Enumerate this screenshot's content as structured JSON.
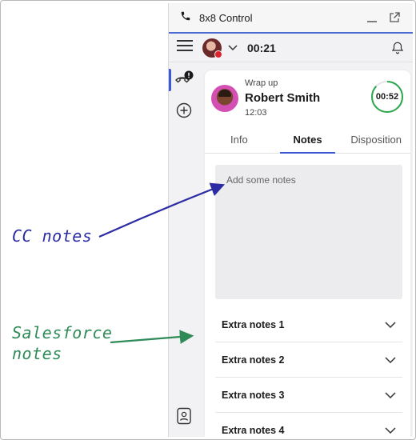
{
  "annotations": {
    "cc_notes": "CC notes",
    "salesforce_line1": "Salesforce",
    "salesforce_line2": "notes"
  },
  "window": {
    "title": "8x8 Control",
    "minimize_icon": "minimize-icon",
    "popout_icon": "popout-icon"
  },
  "statusbar": {
    "menu_icon": "hamburger-icon",
    "timer": "00:21",
    "bell_icon": "bell-icon"
  },
  "rail": {
    "items": [
      {
        "icon": "phone-alert-icon",
        "active": true
      },
      {
        "icon": "plus-circle-icon",
        "active": false
      }
    ],
    "bottom_icon": "contacts-icon"
  },
  "call": {
    "status_label": "Wrap up",
    "caller_name": "Robert Smith",
    "time": "12:03",
    "wrapup_countdown": "00:52",
    "wrapup_progress": 0.87
  },
  "tabs": [
    {
      "label": "Info",
      "active": false
    },
    {
      "label": "Notes",
      "active": true
    },
    {
      "label": "Disposition",
      "active": false
    }
  ],
  "notes": {
    "placeholder": "Add some notes"
  },
  "extra_notes": [
    {
      "label": "Extra notes 1"
    },
    {
      "label": "Extra notes 2"
    },
    {
      "label": "Extra notes 3"
    },
    {
      "label": "Extra notes 4"
    }
  ],
  "colors": {
    "accent": "#3b5bd6",
    "countdown_ring": "#2aa84a",
    "cc_annotation": "#2b2ba3",
    "salesforce_annotation": "#2e8b57"
  }
}
